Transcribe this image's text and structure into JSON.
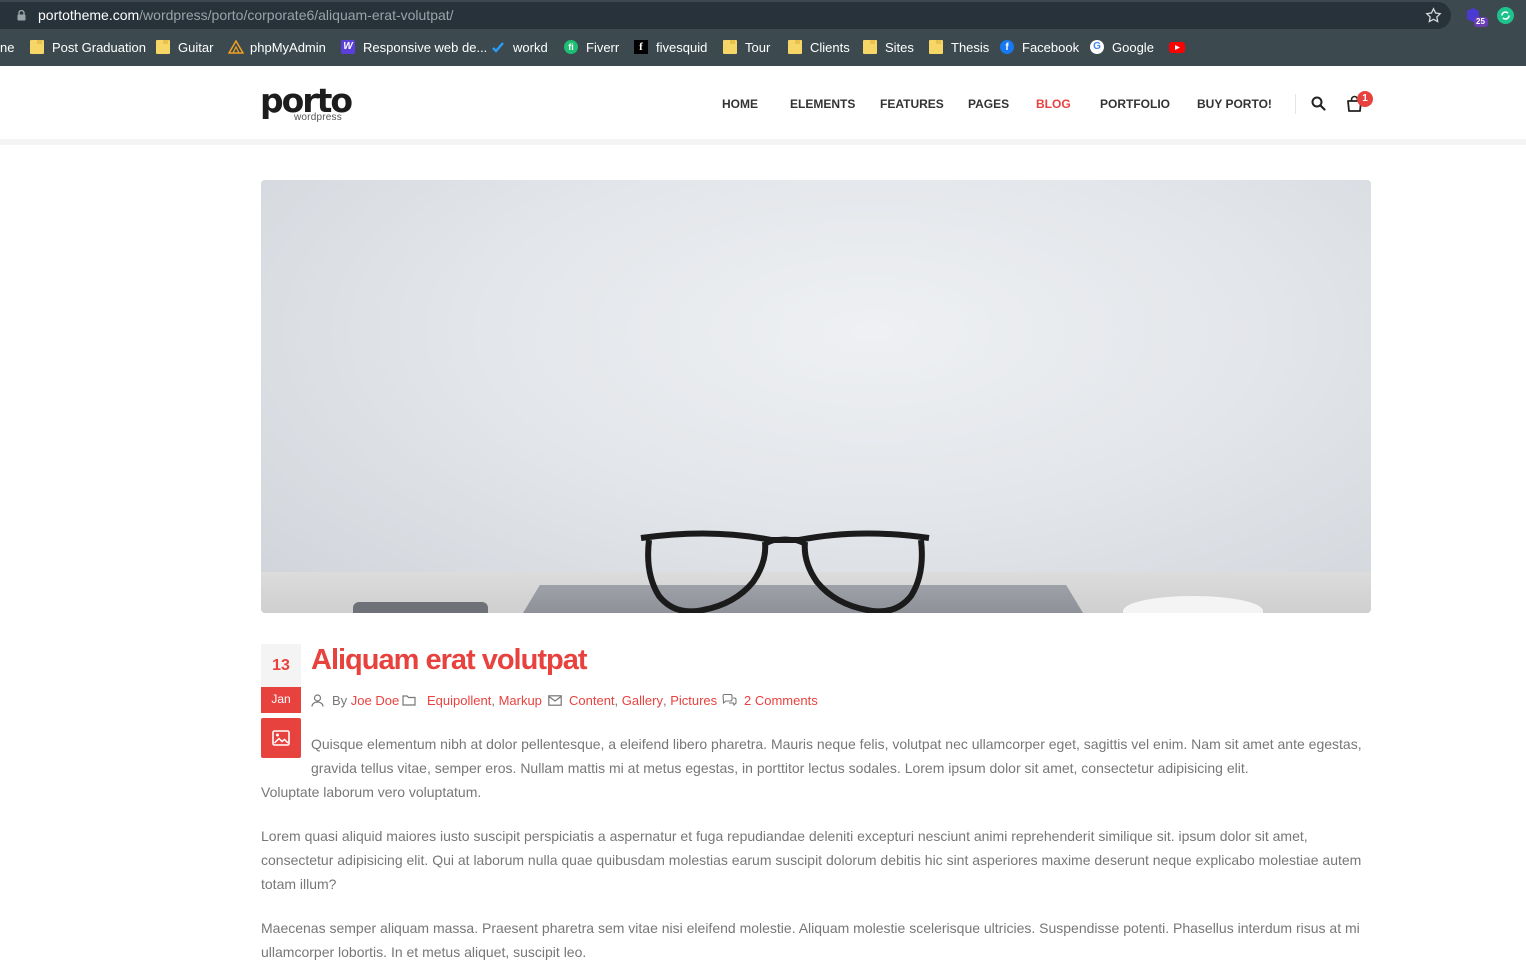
{
  "browser": {
    "url_host": "portotheme.com",
    "url_path": "/wordpress/porto/corporate6/aliquam-erat-volutpat/",
    "extension_badge": "25",
    "bookmarks": [
      {
        "label": "ne",
        "icon": "truncated-item"
      },
      {
        "label": "Post Graduation",
        "icon": "folder-icon"
      },
      {
        "label": "Guitar",
        "icon": "folder-icon"
      },
      {
        "label": "phpMyAdmin",
        "icon": "phpmyadmin-icon"
      },
      {
        "label": "Responsive web de...",
        "icon": "w-icon"
      },
      {
        "label": "workd",
        "icon": "workd-icon"
      },
      {
        "label": "Fiverr",
        "icon": "fiverr-icon"
      },
      {
        "label": "fivesquid",
        "icon": "fivesquid-icon"
      },
      {
        "label": "Tour",
        "icon": "folder-icon"
      },
      {
        "label": "Clients",
        "icon": "folder-icon"
      },
      {
        "label": "Sites",
        "icon": "folder-icon"
      },
      {
        "label": "Thesis",
        "icon": "folder-icon"
      },
      {
        "label": "Facebook",
        "icon": "facebook-icon"
      },
      {
        "label": "Google",
        "icon": "google-icon"
      },
      {
        "label": "",
        "icon": "youtube-icon"
      }
    ]
  },
  "site": {
    "logo": "porto",
    "logo_sub": "wordpress",
    "nav": [
      "HOME",
      "ELEMENTS",
      "FEATURES",
      "PAGES",
      "BLOG",
      "PORTFOLIO",
      "BUY PORTO!"
    ],
    "nav_active": "BLOG",
    "cart_count": "1",
    "accent_color": "#e8423f"
  },
  "post": {
    "day": "13",
    "month": "Jan",
    "title": "Aliquam erat volutpat",
    "by": "By",
    "author": "Joe Doe",
    "categories": [
      "Equipollent",
      "Markup"
    ],
    "tags": [
      "Content",
      "Gallery",
      "Pictures"
    ],
    "comments": "2 Comments",
    "p1_a": "Quisque elementum nibh at dolor pellentesque, a eleifend libero pharetra. Mauris neque felis, volutpat nec ullamcorper eget, sagittis vel enim. Nam sit amet ante egestas, gravida tellus vitae, semper eros. Nullam mattis mi at metus egestas, in porttitor lectus sodales. Lorem ipsum dolor sit amet, consectetur adipisicing elit.",
    "p1_b": "Voluptate laborum vero voluptatum.",
    "p2": "Lorem quasi aliquid maiores iusto suscipit perspiciatis a aspernatur et fuga repudiandae deleniti excepturi nesciunt animi reprehenderit similique sit. ipsum dolor sit amet, consectetur adipisicing elit. Qui at laborum nulla quae quibusdam molestias earum suscipit dolorum debitis hic sint asperiores maxime deserunt neque explicabo molestiae autem totam illum?",
    "p3": "Maecenas semper aliquam massa. Praesent pharetra sem vitae nisi eleifend molestie. Aliquam molestie scelerisque ultricies. Suspendisse potenti. Phasellus interdum risus at mi ullamcorper lobortis. In et metus aliquet, suscipit leo."
  }
}
